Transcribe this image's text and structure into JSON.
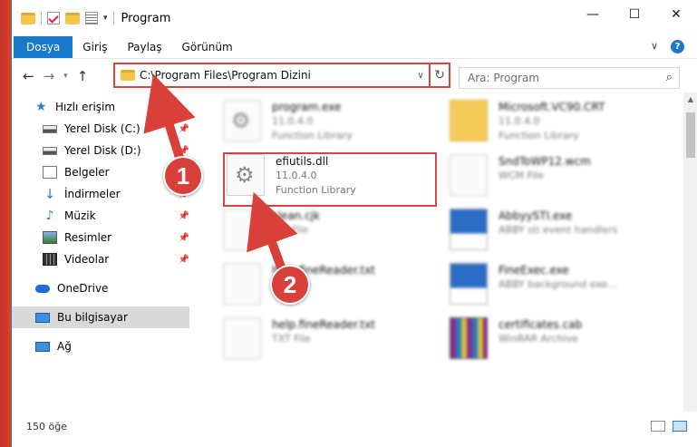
{
  "window": {
    "title": "Program",
    "controls": {
      "minimize": "—",
      "maximize": "☐",
      "close": "✕"
    }
  },
  "ribbon": {
    "tabs": [
      {
        "label": "Dosya",
        "active": true
      },
      {
        "label": "Giriş"
      },
      {
        "label": "Paylaş"
      },
      {
        "label": "Görünüm"
      }
    ],
    "expand_glyph": "∨",
    "help_glyph": "?"
  },
  "nav": {
    "back": "←",
    "forward": "→",
    "recent": "▾",
    "up": "↑"
  },
  "address": {
    "path": "C:\\Program Files\\Program Dizini",
    "chevron": "∨",
    "refresh": "↻"
  },
  "search": {
    "placeholder": "Ara: Program",
    "icon": "⌕"
  },
  "sidebar": {
    "items": [
      {
        "label": "Hızlı erişim",
        "icon": "star-icon",
        "glyph": "★"
      },
      {
        "label": "Yerel Disk (C:)",
        "icon": "drive-icon",
        "pinned": true
      },
      {
        "label": "Yerel Disk (D:)",
        "icon": "drive-icon",
        "pinned": true
      },
      {
        "label": "Belgeler",
        "icon": "documents-icon",
        "pinned": true
      },
      {
        "label": "İndirmeler",
        "icon": "download-icon",
        "glyph": "↓",
        "pinned": true
      },
      {
        "label": "Müzik",
        "icon": "music-icon",
        "glyph": "♪",
        "pinned": true
      },
      {
        "label": "Resimler",
        "icon": "pictures-icon",
        "pinned": true
      },
      {
        "label": "Videolar",
        "icon": "videos-icon",
        "pinned": true
      },
      {
        "label": "OneDrive",
        "icon": "cloud-icon"
      },
      {
        "label": "Bu bilgisayar",
        "icon": "computer-icon",
        "selected": true
      },
      {
        "label": "Ağ",
        "icon": "network-icon"
      }
    ],
    "pin_glyph": "📌"
  },
  "files": [
    {
      "name": "program.exe",
      "line2": "11.0.4.0",
      "line3": "Function Library",
      "icon": "gear-doc-icon",
      "blurred": true
    },
    {
      "name": "Microsoft.VC90.CRT",
      "line2": "11.0.4.0",
      "line3": "Function Library",
      "icon": "folder-icon",
      "blurred": true
    },
    {
      "name": "efiutils.dll",
      "line2": "11.0.4.0",
      "line3": "Function Library",
      "icon": "gear-doc-icon",
      "blurred": false
    },
    {
      "name": "SndToWP12.wcm",
      "line2": "WCM File",
      "line3": "",
      "icon": "document-icon",
      "blurred": true
    },
    {
      "name": "clean.cjk",
      "line2": "CJK File",
      "line3": "",
      "icon": "document-icon",
      "blurred": true
    },
    {
      "name": "AbbyySTI.exe",
      "line2": "ABBY sti event handlers",
      "line3": "",
      "icon": "exe-icon",
      "blurred": true
    },
    {
      "name": "help.fineReader.txt",
      "line2": "TXT File",
      "line3": "",
      "icon": "document-icon",
      "blurred": true
    },
    {
      "name": "FineExec.exe",
      "line2": "ABBY background exe...",
      "line3": "",
      "icon": "exe-icon",
      "blurred": true
    },
    {
      "name": "help.fineReader.txt",
      "line2": "TXT File",
      "line3": "",
      "icon": "document-icon",
      "blurred": true
    },
    {
      "name": "certificates.cab",
      "line2": "WinRAR Archive",
      "line3": "",
      "icon": "archive-icon",
      "blurred": true
    }
  ],
  "status": {
    "count": "150 öğe"
  },
  "callouts": {
    "one": "1",
    "two": "2"
  },
  "colors": {
    "accent": "#1979ca",
    "highlight": "#d64545",
    "callout": "#d9403a"
  }
}
